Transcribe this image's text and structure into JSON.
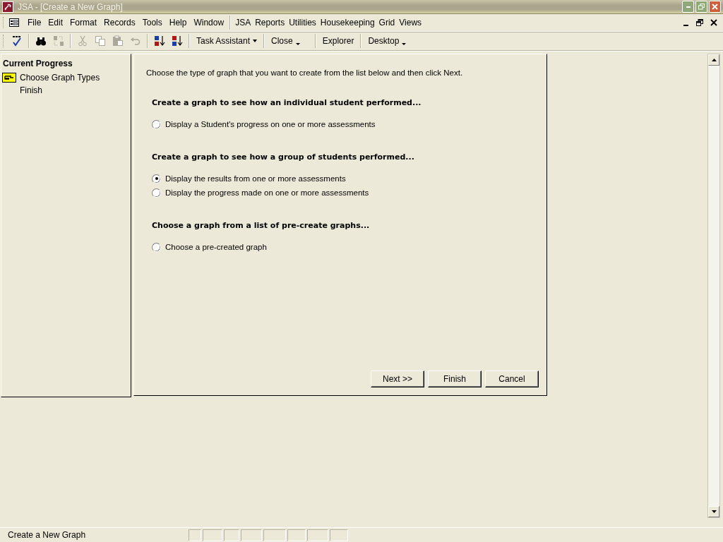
{
  "window": {
    "title": "JSA - [Create a New Graph]"
  },
  "menu": {
    "items": [
      {
        "label": "File"
      },
      {
        "label": "Edit"
      },
      {
        "label": "Format"
      },
      {
        "label": "Records"
      },
      {
        "label": "Tools"
      },
      {
        "label": "Help"
      },
      {
        "label": "Window"
      }
    ],
    "extra_items": [
      {
        "label": "JSA"
      },
      {
        "label": "Reports"
      },
      {
        "label": "Utilities"
      },
      {
        "label": "Housekeeping"
      },
      {
        "label": "Grid"
      },
      {
        "label": "Views"
      }
    ]
  },
  "toolbar": {
    "icons": [
      {
        "kind": "spelling",
        "disabled": false
      },
      {
        "kind": "find",
        "disabled": false
      },
      {
        "kind": "replace",
        "disabled": true
      },
      {
        "kind": "cut",
        "disabled": true
      },
      {
        "kind": "copy",
        "disabled": true
      },
      {
        "kind": "paste",
        "disabled": true
      },
      {
        "kind": "undo",
        "disabled": true
      },
      {
        "kind": "sort-ascending",
        "disabled": false
      },
      {
        "kind": "sort-descending",
        "disabled": false
      }
    ],
    "task_assistant": "Task Assistant",
    "close": "Close",
    "explorer": "Explorer",
    "desktop": "Desktop"
  },
  "progress": {
    "title": "Current Progress",
    "steps": [
      {
        "label": "Choose Graph Types",
        "selected": true
      },
      {
        "label": "Finish",
        "selected": false
      }
    ]
  },
  "wizard": {
    "instruction": "Choose the type of graph that you want to create from the list below and then click Next.",
    "sections": [
      {
        "heading": "Create a graph to see how an individual student performed...",
        "options": [
          {
            "label": "Display a Student's progress on one or more assessments",
            "selected": false
          }
        ]
      },
      {
        "heading": "Create a graph to see how a group of students performed...",
        "options": [
          {
            "label": "Display the results from one or more assessments",
            "selected": true
          },
          {
            "label": "Display the progress made on one or more assessments",
            "selected": false
          }
        ]
      },
      {
        "heading": "Choose a graph from a list of pre-create graphs...",
        "options": [
          {
            "label": "Choose a pre-created graph",
            "selected": false
          }
        ]
      }
    ],
    "buttons": [
      "Next >>",
      "Finish",
      "Cancel"
    ]
  },
  "status_bar": "Create a New Graph"
}
